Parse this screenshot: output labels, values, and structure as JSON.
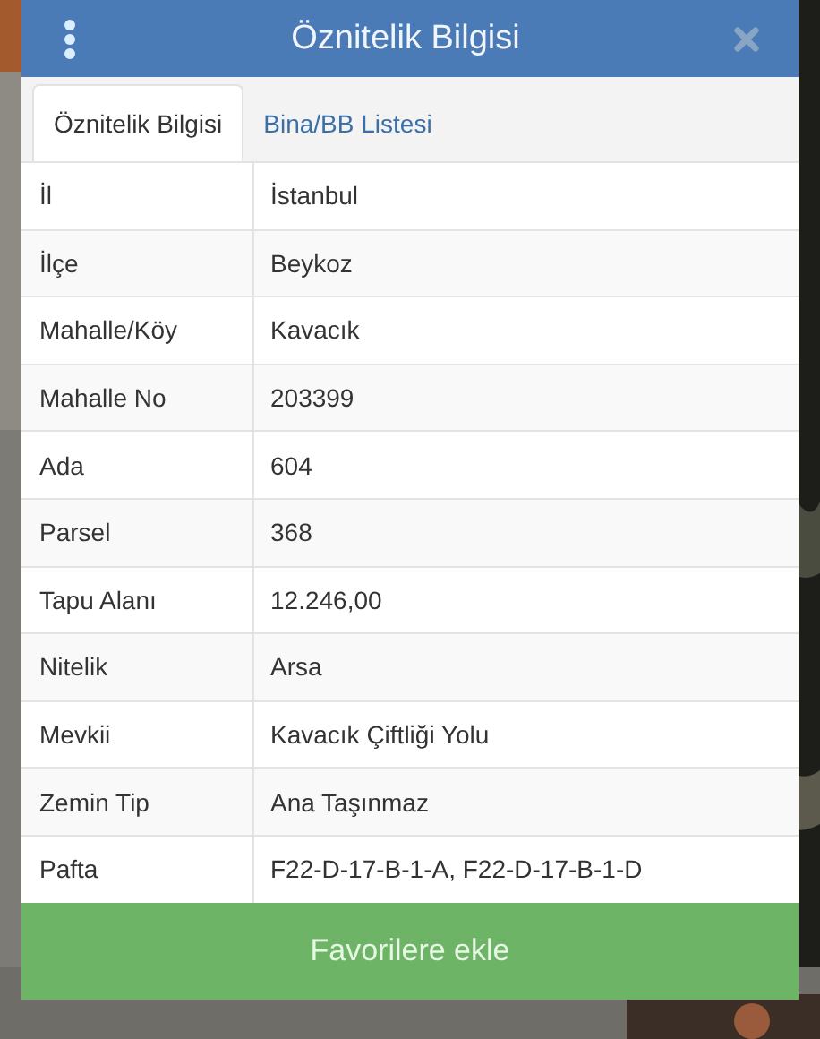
{
  "dialog": {
    "title": "Öznitelik Bilgisi"
  },
  "tabs": [
    {
      "label": "Öznitelik Bilgisi",
      "selected": true
    },
    {
      "label": "Bina/BB Listesi",
      "selected": false
    }
  ],
  "table": {
    "rows": [
      {
        "label": "İl",
        "value": "İstanbul"
      },
      {
        "label": "İlçe",
        "value": "Beykoz"
      },
      {
        "label": "Mahalle/Köy",
        "value": "Kavacık"
      },
      {
        "label": "Mahalle No",
        "value": "203399"
      },
      {
        "label": "Ada",
        "value": "604"
      },
      {
        "label": "Parsel",
        "value": "368"
      },
      {
        "label": "Tapu Alanı",
        "value": "12.246,00"
      },
      {
        "label": "Nitelik",
        "value": "Arsa"
      },
      {
        "label": "Mevkii",
        "value": "Kavacık Çiftliği Yolu"
      },
      {
        "label": "Zemin Tip",
        "value": "Ana Taşınmaz"
      },
      {
        "label": "Pafta",
        "value": "F22-D-17-B-1-A, F22-D-17-B-1-D"
      }
    ]
  },
  "button": {
    "label": "Favorilere ekle"
  }
}
